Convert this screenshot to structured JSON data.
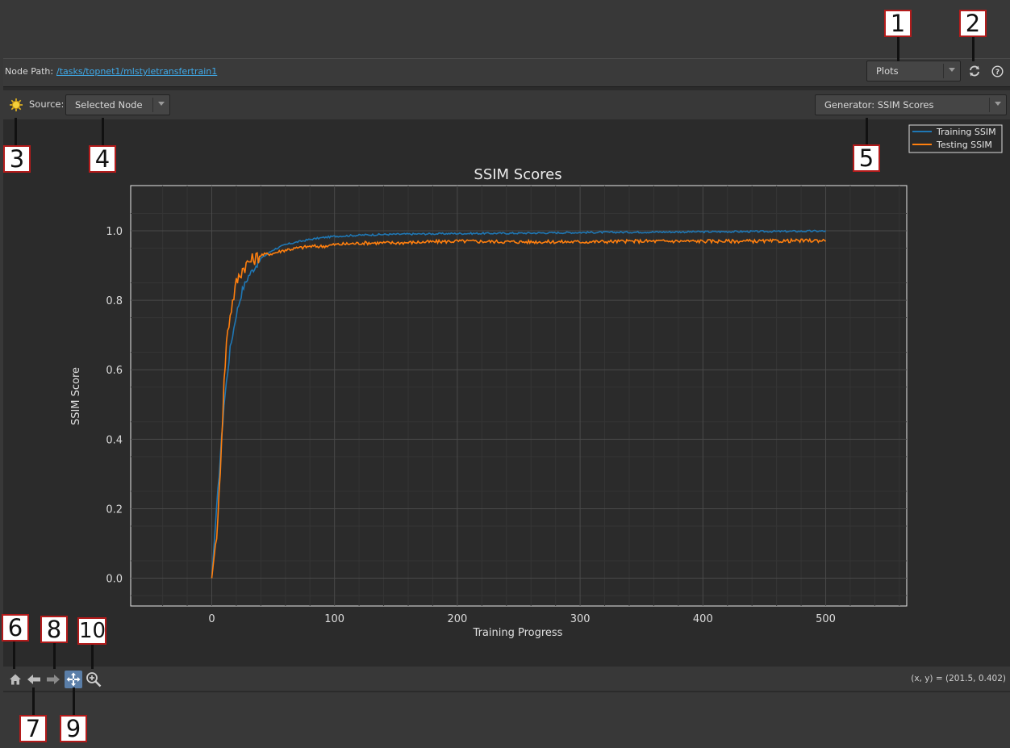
{
  "path_bar": {
    "label": "Node Path:",
    "path": "/tasks/topnet1/mlstyletransfertrain1",
    "view_dropdown": "Plots"
  },
  "toolbar": {
    "source_label": "Source:",
    "source_value": "Selected Node",
    "generator_value": "Generator: SSIM Scores"
  },
  "legend": {
    "entries": [
      "Training SSIM",
      "Testing SSIM"
    ]
  },
  "status": {
    "coords": "(x, y) = (201.5, 0.402)"
  },
  "callouts": [
    "1",
    "2",
    "3",
    "4",
    "5",
    "6",
    "7",
    "8",
    "9",
    "10"
  ],
  "colors": {
    "training": "#1f77b4",
    "testing": "#ff7f0e",
    "link": "#3fa9e8",
    "callout_border": "#b31b1b"
  },
  "icons": {
    "refresh": "refresh-icon",
    "help": "help-icon",
    "source": "sun-icon",
    "home": "home-icon",
    "back": "arrow-left-icon",
    "forward": "arrow-right-icon",
    "pan": "pan-icon",
    "zoom": "zoom-icon"
  },
  "chart_data": {
    "type": "line",
    "title": "SSIM Scores",
    "xlabel": "Training Progress",
    "ylabel": "SSIM Score",
    "xlim": [
      -66,
      566
    ],
    "ylim": [
      -0.08,
      1.13
    ],
    "xticks": [
      "0",
      "100",
      "200",
      "300",
      "400",
      "500"
    ],
    "yticks": [
      "0.0",
      "0.2",
      "0.4",
      "0.6",
      "0.8",
      "1.0"
    ],
    "grid": true,
    "legend_position": "top-right",
    "series": [
      {
        "name": "Training SSIM",
        "x": [
          0,
          5,
          10,
          15,
          20,
          25,
          30,
          40,
          50,
          60,
          70,
          80,
          90,
          100,
          125,
          150,
          200,
          250,
          300,
          350,
          400,
          450,
          500
        ],
        "y": [
          0.0,
          0.25,
          0.5,
          0.66,
          0.76,
          0.83,
          0.87,
          0.92,
          0.945,
          0.96,
          0.968,
          0.975,
          0.98,
          0.984,
          0.988,
          0.99,
          0.992,
          0.993,
          0.995,
          0.996,
          0.997,
          0.998,
          0.999
        ]
      },
      {
        "name": "Testing SSIM",
        "x": [
          0,
          5,
          8,
          10,
          12,
          15,
          20,
          25,
          30,
          35,
          40,
          50,
          60,
          70,
          80,
          90,
          100,
          125,
          150,
          200,
          250,
          300,
          350,
          400,
          450,
          500
        ],
        "y": [
          0.0,
          0.16,
          0.4,
          0.56,
          0.68,
          0.76,
          0.85,
          0.89,
          0.91,
          0.92,
          0.93,
          0.935,
          0.945,
          0.95,
          0.955,
          0.955,
          0.96,
          0.965,
          0.965,
          0.97,
          0.968,
          0.968,
          0.97,
          0.97,
          0.97,
          0.972
        ]
      }
    ]
  }
}
